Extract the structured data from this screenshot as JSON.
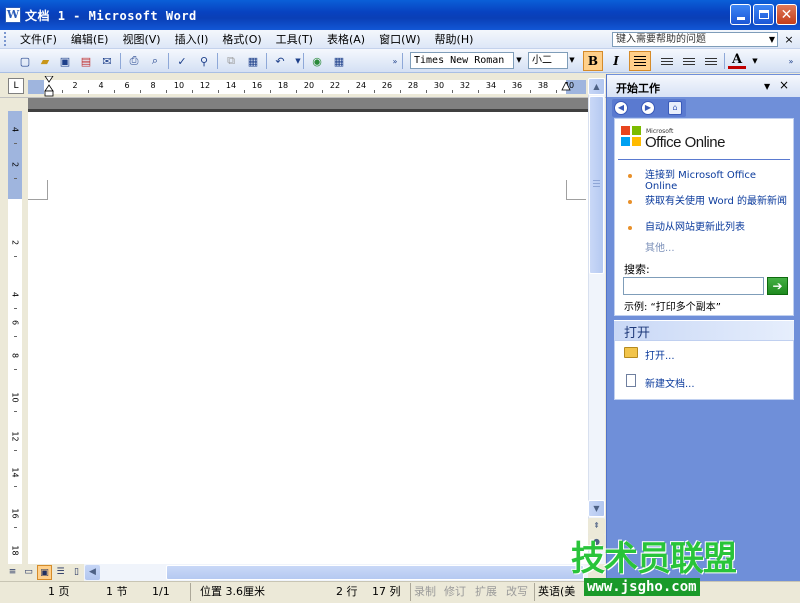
{
  "window": {
    "title": "文档 1 - Microsoft Word",
    "app_icon": "W"
  },
  "menu": {
    "items": [
      "文件(F)",
      "编辑(E)",
      "视图(V)",
      "插入(I)",
      "格式(O)",
      "工具(T)",
      "表格(A)",
      "窗口(W)",
      "帮助(H)"
    ],
    "help_placeholder": "键入需要帮助的问题",
    "close_glyph": "×"
  },
  "toolbar": {
    "font_name": "Times New Roman",
    "font_size": "小二",
    "bold_label": "B",
    "italic_label": "I",
    "font_color_label": "A"
  },
  "ruler": {
    "numbers": [
      "2",
      "4",
      "6",
      "8",
      "10",
      "12",
      "14",
      "16",
      "18",
      "20",
      "22",
      "24",
      "26",
      "28",
      "30",
      "32",
      "34",
      "36",
      "38",
      "40"
    ],
    "vertical_numbers": [
      "4",
      "2",
      "2",
      "4",
      "6",
      "8",
      "10",
      "12",
      "14",
      "16",
      "18"
    ]
  },
  "status": {
    "page": "1 页",
    "section": "1 节",
    "page_count": "1/1",
    "position": "位置 3.6厘米",
    "line": "2 行",
    "column": "17 列",
    "record": "录制",
    "revise": "修订",
    "extend": "扩展",
    "overwrite": "改写",
    "language": "英语(美"
  },
  "task_pane": {
    "title": "开始工作",
    "office_sub": "Microsoft",
    "office_text": "Office Online",
    "links": [
      "连接到 Microsoft Office Online",
      "获取有关使用 Word 的最新新闻",
      "自动从网站更新此列表"
    ],
    "more": "其他...",
    "search_label": "搜索:",
    "example": "示例: “打印多个副本”",
    "open_section": "打开",
    "open_link": "打开...",
    "new_doc_link": "新建文档..."
  },
  "watermark": {
    "text": "技术员联盟",
    "url": "www.jsgho.com"
  }
}
